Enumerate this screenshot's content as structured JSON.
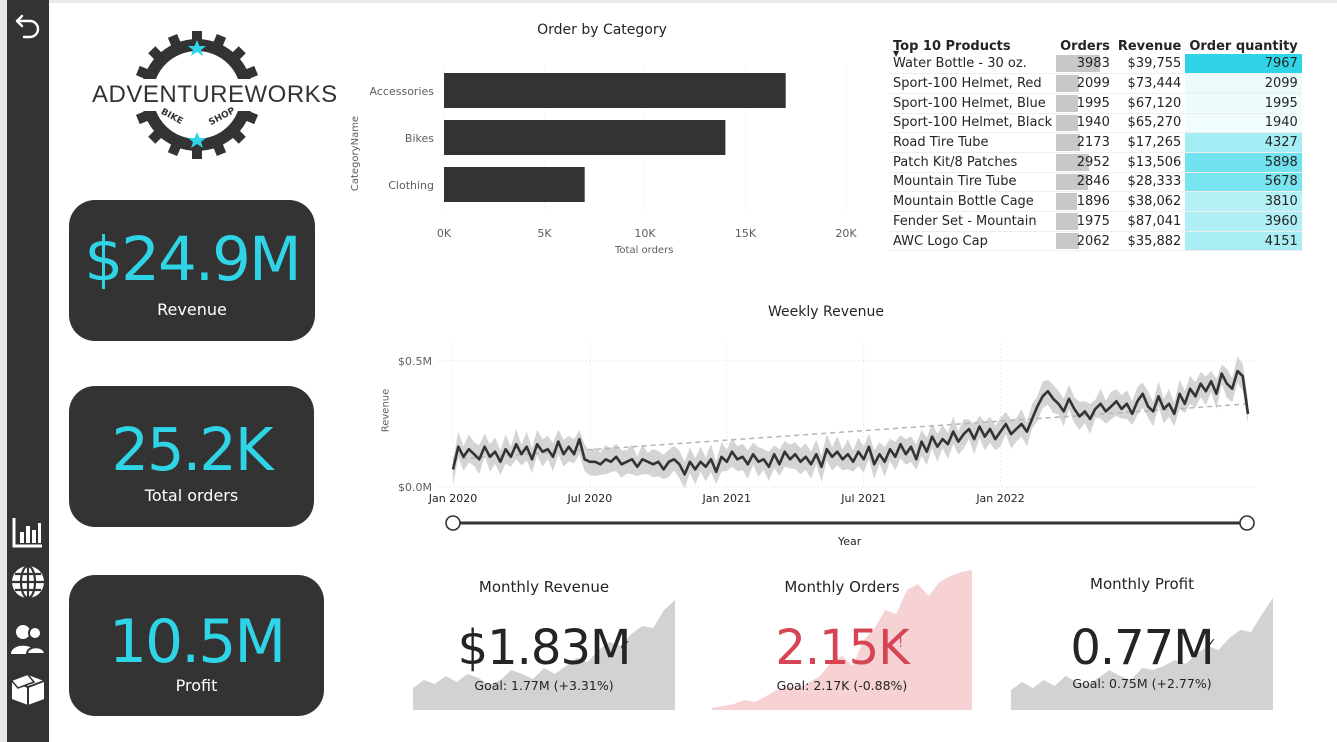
{
  "nav": {
    "icons": [
      "back-arrow-icon",
      "bar-chart-icon",
      "globe-icon",
      "users-icon",
      "box-icon"
    ]
  },
  "logo": {
    "brand": "ADVENTUREWORKS",
    "tagline_left": "BIKE",
    "tagline_right": "SHOP"
  },
  "kpis": {
    "revenue": {
      "value": "$24.9M",
      "label": "Revenue"
    },
    "orders": {
      "value": "25.2K",
      "label": "Total orders"
    },
    "profit": {
      "value": "10.5M",
      "label": "Profit"
    }
  },
  "colors": {
    "accent": "#2fd5e6",
    "panel": "#333333",
    "negative": "#d64554",
    "sparkline": "#d2d2d2",
    "negative_sparkline": "#f6d2d5"
  },
  "order_by_category": {
    "chart_data": {
      "type": "bar",
      "title": "Order by Category",
      "xlabel": "Total orders",
      "ylabel": "CategoryName",
      "categories": [
        "Accessories",
        "Bikes",
        "Clothing"
      ],
      "values": [
        17000,
        14000,
        7000
      ],
      "xlim": [
        0,
        20000
      ],
      "xticks": [
        "0K",
        "5K",
        "10K",
        "15K",
        "20K"
      ],
      "bar_color": "#333333",
      "grid": true
    }
  },
  "top10": {
    "headers": [
      "Top 10 Products",
      "Orders",
      "Revenue",
      "Order quantity"
    ],
    "rows": [
      {
        "product": "Water Bottle - 30 oz.",
        "orders": "3983",
        "revenue": "$39,755",
        "qty": "7967"
      },
      {
        "product": "Sport-100 Helmet, Red",
        "orders": "2099",
        "revenue": "$73,444",
        "qty": "2099"
      },
      {
        "product": "Sport-100 Helmet, Blue",
        "orders": "1995",
        "revenue": "$67,120",
        "qty": "1995"
      },
      {
        "product": "Sport-100 Helmet, Black",
        "orders": "1940",
        "revenue": "$65,270",
        "qty": "1940"
      },
      {
        "product": "Road Tire Tube",
        "orders": "2173",
        "revenue": "$17,265",
        "qty": "4327"
      },
      {
        "product": "Patch Kit/8 Patches",
        "orders": "2952",
        "revenue": "$13,506",
        "qty": "5898"
      },
      {
        "product": "Mountain Tire Tube",
        "orders": "2846",
        "revenue": "$28,333",
        "qty": "5678"
      },
      {
        "product": "Mountain Bottle Cage",
        "orders": "1896",
        "revenue": "$38,062",
        "qty": "3810"
      },
      {
        "product": "Fender Set - Mountain",
        "orders": "1975",
        "revenue": "$87,041",
        "qty": "3960"
      },
      {
        "product": "AWC Logo Cap",
        "orders": "2062",
        "revenue": "$35,882",
        "qty": "4151"
      }
    ]
  },
  "weekly_revenue": {
    "chart_data": {
      "type": "line",
      "title": "Weekly Revenue",
      "xlabel": "Year",
      "ylabel": "Revenue",
      "ylim": [
        0,
        0.5
      ],
      "yticks": [
        "$0.0M",
        "$0.5M"
      ],
      "xticks": [
        "Jan 2020",
        "Jul 2020",
        "Jan 2021",
        "Jul 2021",
        "Jan 2022"
      ],
      "x_start_week": "Jan 2020",
      "series": [
        {
          "values": [
            0.07,
            0.16,
            0.12,
            0.15,
            0.13,
            0.11,
            0.16,
            0.12,
            0.14,
            0.1,
            0.15,
            0.12,
            0.17,
            0.13,
            0.16,
            0.11,
            0.17,
            0.14,
            0.15,
            0.12,
            0.18,
            0.13,
            0.16,
            0.13,
            0.19,
            0.11,
            0.1,
            0.1,
            0.09,
            0.11,
            0.1,
            0.12,
            0.09,
            0.1,
            0.11,
            0.08,
            0.11,
            0.1,
            0.09,
            0.1,
            0.07,
            0.1,
            0.11,
            0.09,
            0.05,
            0.1,
            0.07,
            0.1,
            0.08,
            0.11,
            0.06,
            0.12,
            0.1,
            0.14,
            0.11,
            0.12,
            0.09,
            0.13,
            0.1,
            0.11,
            0.08,
            0.13,
            0.09,
            0.14,
            0.11,
            0.13,
            0.1,
            0.12,
            0.09,
            0.13,
            0.08,
            0.15,
            0.12,
            0.14,
            0.11,
            0.13,
            0.1,
            0.14,
            0.11,
            0.16,
            0.09,
            0.13,
            0.1,
            0.15,
            0.12,
            0.17,
            0.13,
            0.16,
            0.11,
            0.18,
            0.14,
            0.2,
            0.16,
            0.19,
            0.17,
            0.22,
            0.18,
            0.21,
            0.23,
            0.19,
            0.24,
            0.2,
            0.23,
            0.19,
            0.22,
            0.25,
            0.21,
            0.23,
            0.25,
            0.22,
            0.27,
            0.32,
            0.36,
            0.38,
            0.35,
            0.33,
            0.3,
            0.35,
            0.31,
            0.28,
            0.3,
            0.27,
            0.31,
            0.33,
            0.3,
            0.32,
            0.34,
            0.31,
            0.33,
            0.29,
            0.34,
            0.37,
            0.32,
            0.3,
            0.36,
            0.31,
            0.33,
            0.29,
            0.37,
            0.33,
            0.39,
            0.36,
            0.41,
            0.38,
            0.42,
            0.37,
            0.45,
            0.41,
            0.39,
            0.46,
            0.44,
            0.29
          ]
        }
      ],
      "trend": {
        "start": 0.11,
        "end": 0.33
      },
      "band_color": "#cfcfcf",
      "line_color": "#333333"
    }
  },
  "monthly": {
    "revenue": {
      "title": "Monthly Revenue",
      "value": "$1.83M",
      "goal": "Goal: 1.77M (+3.31%)",
      "status_icon": "checkmark-icon"
    },
    "orders": {
      "title": "Monthly Orders",
      "value": "2.15K",
      "goal": "Goal: 2.17K (-0.88%)",
      "status_icon": "exclamation-icon",
      "status_text": "!"
    },
    "profit": {
      "title": "Monthly Profit",
      "value": "0.77M",
      "goal": "Goal: 0.75M (+2.77%)",
      "status_icon": "checkmark-icon"
    }
  }
}
